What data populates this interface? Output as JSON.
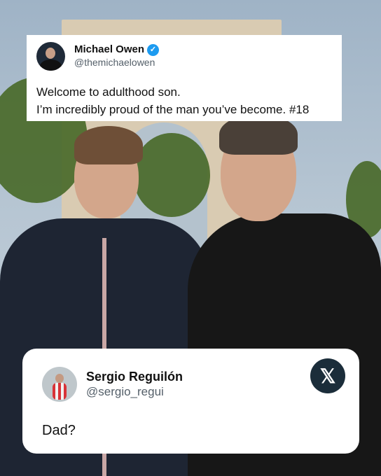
{
  "tweet": {
    "display_name": "Michael Owen",
    "handle": "@themichaelowen",
    "line1": "Welcome to adulthood son.",
    "line2": "I’m incredibly proud of the man you’ve become. #18"
  },
  "reply": {
    "display_name": "Sergio Reguilón",
    "handle": "@sergio_regui",
    "text": "Dad?"
  },
  "icons": {
    "verified": "verified-badge-icon",
    "brand": "x-logo-icon"
  },
  "colors": {
    "verified": "#1d9bf0",
    "x_badge": "#1b2d3a"
  }
}
